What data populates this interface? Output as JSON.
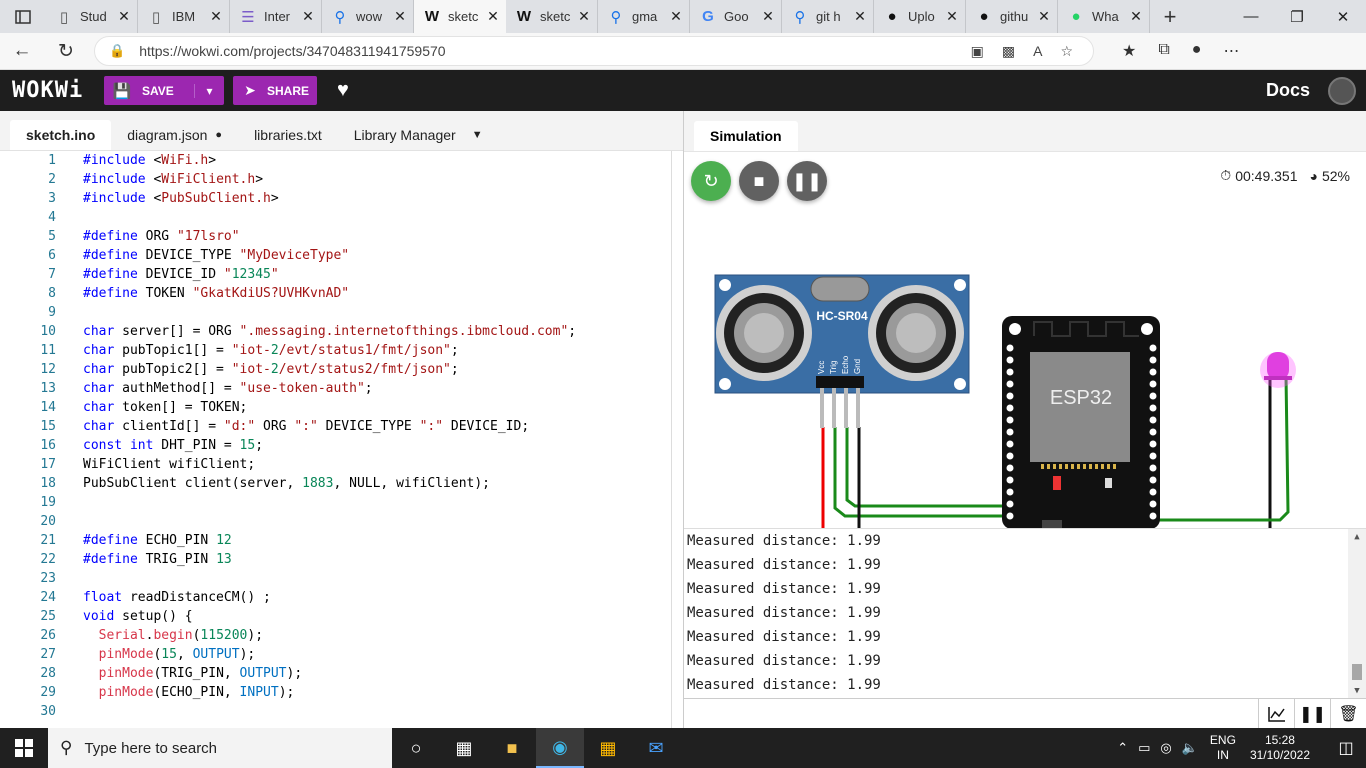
{
  "browser": {
    "tabs": [
      {
        "label": "Stud",
        "icon": "page-icon"
      },
      {
        "label": "IBM",
        "icon": "page-icon"
      },
      {
        "label": "Inter",
        "icon": "list-icon"
      },
      {
        "label": "wow",
        "icon": "search-icon"
      },
      {
        "label": "sketc",
        "icon": "wokwi-icon",
        "active": true
      },
      {
        "label": "sketc",
        "icon": "wokwi-icon"
      },
      {
        "label": "gma",
        "icon": "search-icon"
      },
      {
        "label": "Goo",
        "icon": "google-icon"
      },
      {
        "label": "git h",
        "icon": "search-icon"
      },
      {
        "label": "Uplo",
        "icon": "github-icon"
      },
      {
        "label": "githu",
        "icon": "github-icon"
      },
      {
        "label": "Wha",
        "icon": "whatsapp-icon"
      }
    ],
    "url": "https://wokwi.com/projects/347048311941759570"
  },
  "wokwi": {
    "logo": "WOKWi",
    "save_label": "SAVE",
    "share_label": "SHARE",
    "docs_label": "Docs"
  },
  "editor": {
    "tabs": [
      "sketch.ino",
      "diagram.json",
      "libraries.txt",
      "Library Manager"
    ],
    "lines": [
      {
        "n": "1",
        "t": "#include <WiFi.h>"
      },
      {
        "n": "2",
        "t": "#include <WiFiClient.h>"
      },
      {
        "n": "3",
        "t": "#include <PubSubClient.h>"
      },
      {
        "n": "4",
        "t": ""
      },
      {
        "n": "5",
        "t": "#define ORG \"17lsro\""
      },
      {
        "n": "6",
        "t": "#define DEVICE_TYPE \"MyDeviceType\""
      },
      {
        "n": "7",
        "t": "#define DEVICE_ID \"12345\""
      },
      {
        "n": "8",
        "t": "#define TOKEN \"GkatKdiUS?UVHKvnAD\""
      },
      {
        "n": "9",
        "t": ""
      },
      {
        "n": "10",
        "t": "char server[] = ORG \".messaging.internetofthings.ibmcloud.com\";"
      },
      {
        "n": "11",
        "t": "char pubTopic1[] = \"iot-2/evt/status1/fmt/json\";"
      },
      {
        "n": "12",
        "t": "char pubTopic2[] = \"iot-2/evt/status2/fmt/json\";"
      },
      {
        "n": "13",
        "t": "char authMethod[] = \"use-token-auth\";"
      },
      {
        "n": "14",
        "t": "char token[] = TOKEN;"
      },
      {
        "n": "15",
        "t": "char clientId[] = \"d:\" ORG \":\" DEVICE_TYPE \":\" DEVICE_ID;"
      },
      {
        "n": "16",
        "t": "const int DHT_PIN = 15;"
      },
      {
        "n": "17",
        "t": "WiFiClient wifiClient;"
      },
      {
        "n": "18",
        "t": "PubSubClient client(server, 1883, NULL, wifiClient);"
      },
      {
        "n": "19",
        "t": ""
      },
      {
        "n": "20",
        "t": ""
      },
      {
        "n": "21",
        "t": "#define ECHO_PIN 12"
      },
      {
        "n": "22",
        "t": "#define TRIG_PIN 13"
      },
      {
        "n": "23",
        "t": ""
      },
      {
        "n": "24",
        "t": "float readDistanceCM() ;"
      },
      {
        "n": "25",
        "t": "void setup() {"
      },
      {
        "n": "26",
        "t": "  Serial.begin(115200);"
      },
      {
        "n": "27",
        "t": "  pinMode(15, OUTPUT);"
      },
      {
        "n": "28",
        "t": "  pinMode(TRIG_PIN, OUTPUT);"
      },
      {
        "n": "29",
        "t": "  pinMode(ECHO_PIN, INPUT);"
      },
      {
        "n": "30",
        "t": ""
      }
    ]
  },
  "simulation": {
    "tab_label": "Simulation",
    "timer": "00:49.351",
    "speed": "52%",
    "sensor_label": "HC-SR04",
    "sensor_pins": [
      "Vcc",
      "Trig",
      "Echo",
      "Gnd"
    ],
    "mcu_label": "ESP32",
    "serial_lines": [
      "Measured distance: 1.99",
      "Measured distance: 1.99",
      "Measured distance: 1.99",
      "Measured distance: 1.99",
      "Measured distance: 1.99",
      "Measured distance: 1.99",
      "Measured distance: 1.99"
    ]
  },
  "taskbar": {
    "search_placeholder": "Type here to search",
    "lang_1": "ENG",
    "lang_2": "IN",
    "time": "15:28",
    "date": "31/10/2022"
  }
}
